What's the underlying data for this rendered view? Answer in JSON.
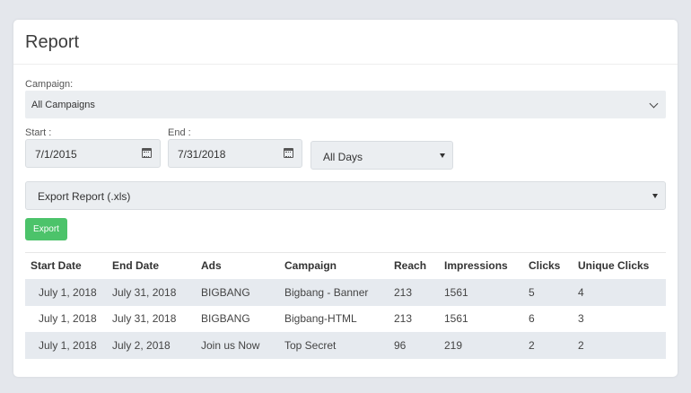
{
  "report": {
    "title": "Report",
    "campaign_label": "Campaign:",
    "campaign_value": "All Campaigns",
    "start_label": "Start :",
    "start_value": "7/1/2015",
    "end_label": "End :",
    "end_value": "7/31/2018",
    "days_value": "All Days",
    "export_format_value": "Export Report (.xls)",
    "export_button": "Export"
  },
  "table": {
    "headers": [
      "Start Date",
      "End Date",
      "Ads",
      "Campaign",
      "Reach",
      "Impressions",
      "Clicks",
      "Unique Clicks"
    ],
    "rows": [
      [
        "July 1, 2018",
        "July 31, 2018",
        "BIGBANG",
        "Bigbang - Banner",
        "213",
        "1561",
        "5",
        "4"
      ],
      [
        "July 1, 2018",
        "July 31, 2018",
        "BIGBANG",
        "Bigbang-HTML",
        "213",
        "1561",
        "6",
        "3"
      ],
      [
        "July 1, 2018",
        "July 2, 2018",
        "Join us Now",
        "Top Secret",
        "96",
        "219",
        "2",
        "2"
      ]
    ]
  },
  "colors": {
    "accent_button": "#4cc36a",
    "row_stripe": "#e6eaef",
    "page_background": "#e4e7ec"
  }
}
